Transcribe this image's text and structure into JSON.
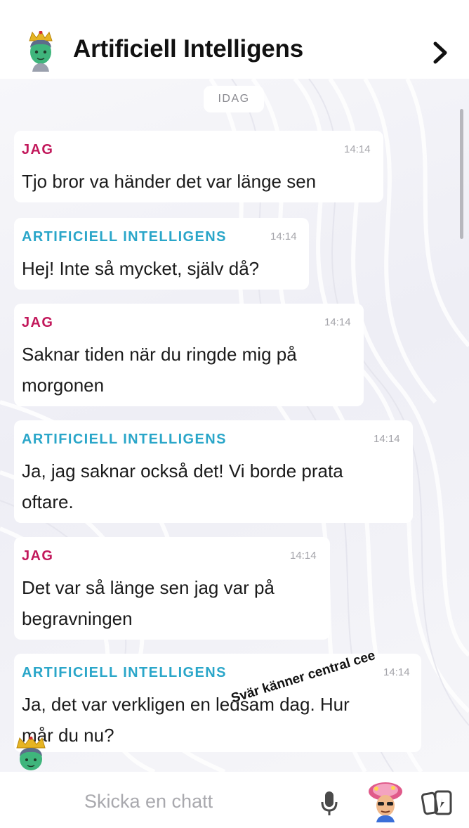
{
  "header": {
    "title": "Artificiell Intelligens",
    "avatar_icon": "bitmoji-crown-avatar-icon",
    "chevron_icon": "chevron-right-icon"
  },
  "date_label": "IDAG",
  "messages": [
    {
      "sender": "JAG",
      "time": "14:14",
      "lines": [
        "Tjo bror va händer det var länge sen"
      ]
    },
    {
      "sender": "ARTIFICIELL INTELLIGENS",
      "time": "14:14",
      "lines": [
        "Hej! Inte så mycket, själv då?"
      ]
    },
    {
      "sender": "JAG",
      "time": "14:14",
      "lines": [
        "Saknar tiden när du ringde mig på",
        "morgonen"
      ]
    },
    {
      "sender": "ARTIFICIELL INTELLIGENS",
      "time": "14:14",
      "lines": [
        "Ja, jag saknar också det! Vi borde prata",
        "oftare."
      ]
    },
    {
      "sender": "JAG",
      "time": "14:14",
      "lines": [
        "Det var så länge sen jag var på",
        "begravningen"
      ]
    },
    {
      "sender": "ARTIFICIELL INTELLIGENS",
      "time": "14:14",
      "lines": [
        "Ja, det var verkligen en ledsam dag. Hur",
        "mår du nu?"
      ]
    }
  ],
  "overlay_text": "Svär känner central cee",
  "input": {
    "placeholder": "Skicka en chatt",
    "camera_icon": "camera-icon",
    "mic_icon": "microphone-icon",
    "bitmoji_icon": "bitmoji-sticker-icon",
    "cards_icon": "cards-icon"
  },
  "colors": {
    "me": "#c2185b",
    "ai": "#2aa6c9"
  }
}
